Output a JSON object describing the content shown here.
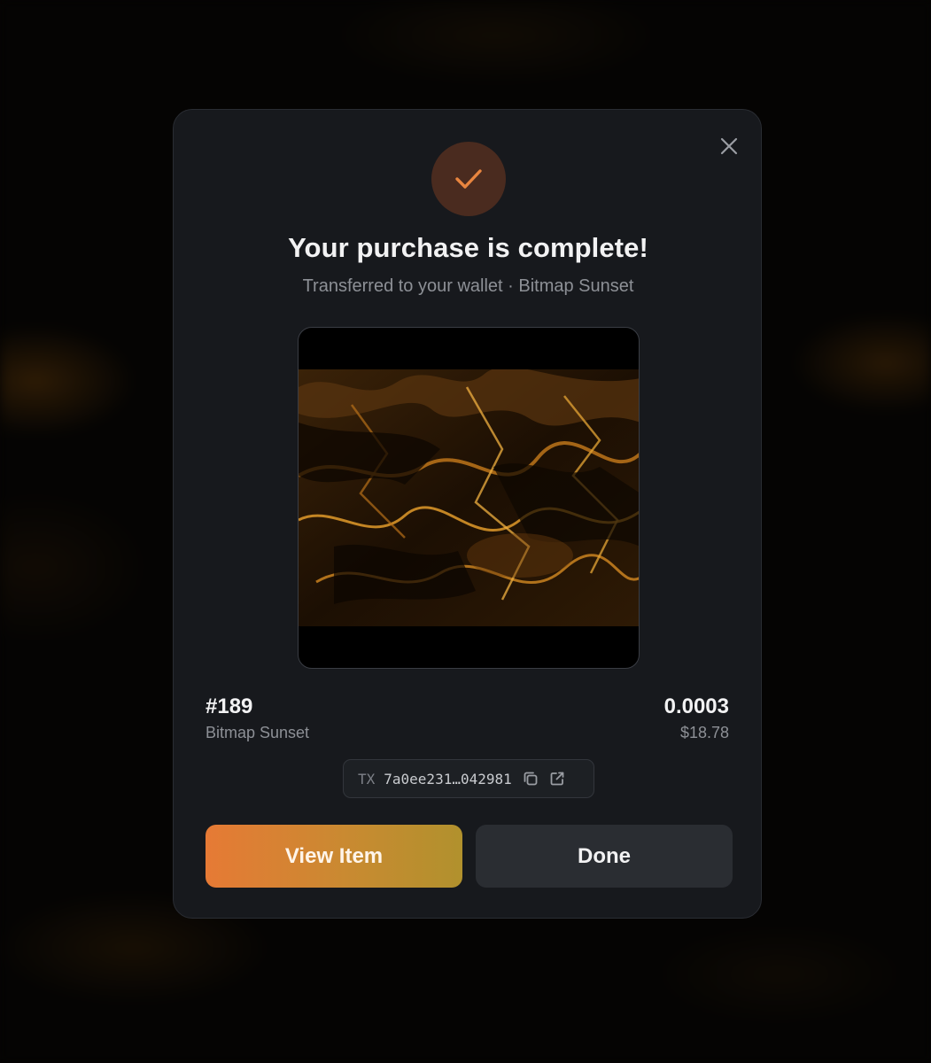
{
  "modal": {
    "title": "Your purchase is complete!",
    "subtitle": "Transferred to your wallet · Bitmap Sunset",
    "close_icon": "close-icon",
    "success_icon": "check-icon",
    "accent_color": "#e8853f"
  },
  "item": {
    "number": "#189",
    "collection": "Bitmap Sunset",
    "price_btc": "0.0003",
    "price_usd": "$18.78"
  },
  "transaction": {
    "label": "TX",
    "hash": "7a0ee231…042981",
    "copy_icon": "copy-icon",
    "external_icon": "external-link-icon"
  },
  "actions": {
    "primary_label": "View Item",
    "secondary_label": "Done"
  }
}
